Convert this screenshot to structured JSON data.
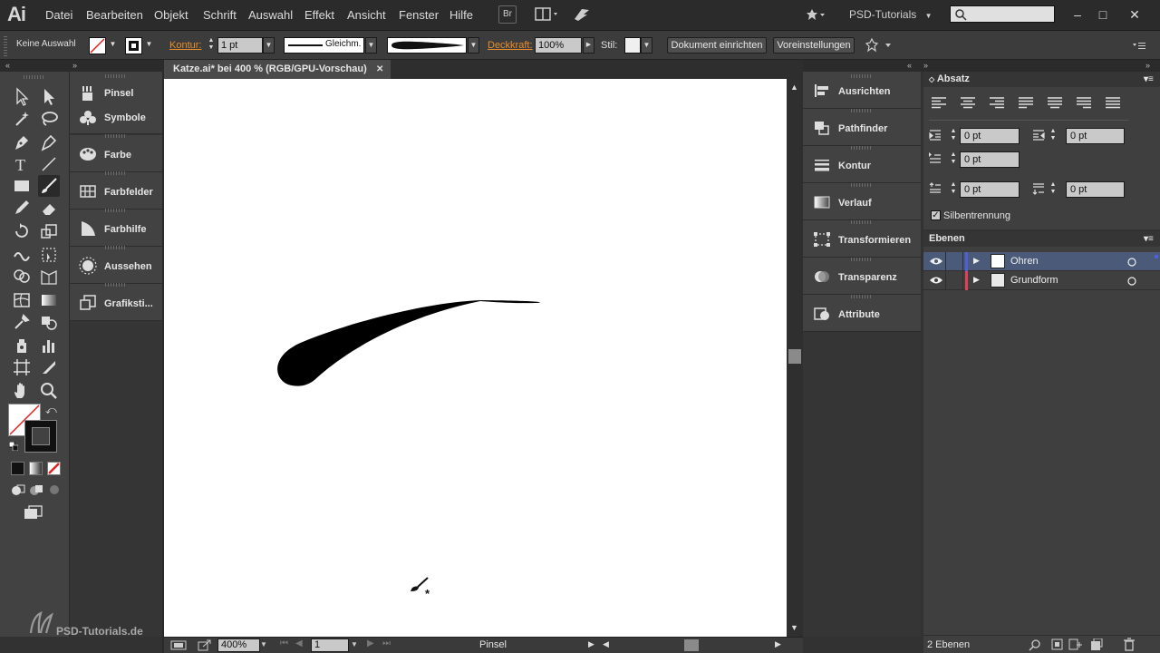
{
  "app": {
    "logo": "Ai"
  },
  "menu": [
    "Datei",
    "Bearbeiten",
    "Objekt",
    "Schrift",
    "Auswahl",
    "Effekt",
    "Ansicht",
    "Fenster",
    "Hilfe"
  ],
  "menubar_right": {
    "bridge_label": "Br",
    "workspace": "PSD-Tutorials",
    "search_placeholder": ""
  },
  "controlbar": {
    "selection_state": "Keine Auswahl",
    "stroke_label": "Kontur:",
    "stroke_weight": "1 pt",
    "stroke_profile": "Gleichm.",
    "opacity_label": "Deckkraft:",
    "opacity_value": "100%",
    "style_label": "Stil:",
    "doc_setup_button": "Dokument einrichten",
    "preferences_button": "Voreinstellungen"
  },
  "document": {
    "tab_title": "Katze.ai* bei 400 % (RGB/GPU-Vorschau)",
    "zoom": "400%",
    "artboard": "1",
    "status_tool": "Pinsel"
  },
  "left_dock": {
    "items": [
      {
        "label": "Pinsel",
        "icon": "brush-icon"
      },
      {
        "label": "Symbole",
        "icon": "symbols-icon"
      },
      {
        "label": "Farbe",
        "icon": "palette-icon"
      },
      {
        "label": "Farbfelder",
        "icon": "swatches-icon"
      },
      {
        "label": "Farbhilfe",
        "icon": "color-guide-icon"
      },
      {
        "label": "Aussehen",
        "icon": "appearance-icon"
      },
      {
        "label": "Grafiksti...",
        "icon": "graphic-styles-icon"
      }
    ]
  },
  "right_dock": {
    "items": [
      {
        "label": "Ausrichten",
        "icon": "align-icon"
      },
      {
        "label": "Pathfinder",
        "icon": "pathfinder-icon"
      },
      {
        "label": "Kontur",
        "icon": "stroke-icon"
      },
      {
        "label": "Verlauf",
        "icon": "gradient-icon"
      },
      {
        "label": "Transformieren",
        "icon": "transform-icon"
      },
      {
        "label": "Transparenz",
        "icon": "transparency-icon"
      },
      {
        "label": "Attribute",
        "icon": "attributes-icon"
      }
    ]
  },
  "paragraph_panel": {
    "title": "Absatz",
    "left_indent": "0 pt",
    "right_indent": "0 pt",
    "first_line_indent": "0 pt",
    "space_before": "0 pt",
    "space_after": "0 pt",
    "hyphenation_label": "Silbentrennung",
    "hyphenation_checked": true
  },
  "layers_panel": {
    "title": "Ebenen",
    "layers": [
      {
        "name": "Ohren",
        "color": "#4f5fd6",
        "selected": true
      },
      {
        "name": "Grundform",
        "color": "#e0405a",
        "selected": false
      }
    ],
    "count_label": "2 Ebenen"
  },
  "watermark": "PSD-Tutorials.de",
  "colors": {
    "ui_bg": "#323232",
    "panel": "#424242",
    "accent_orange": "#e88e2c",
    "layer_selected": "#4a5a78"
  }
}
